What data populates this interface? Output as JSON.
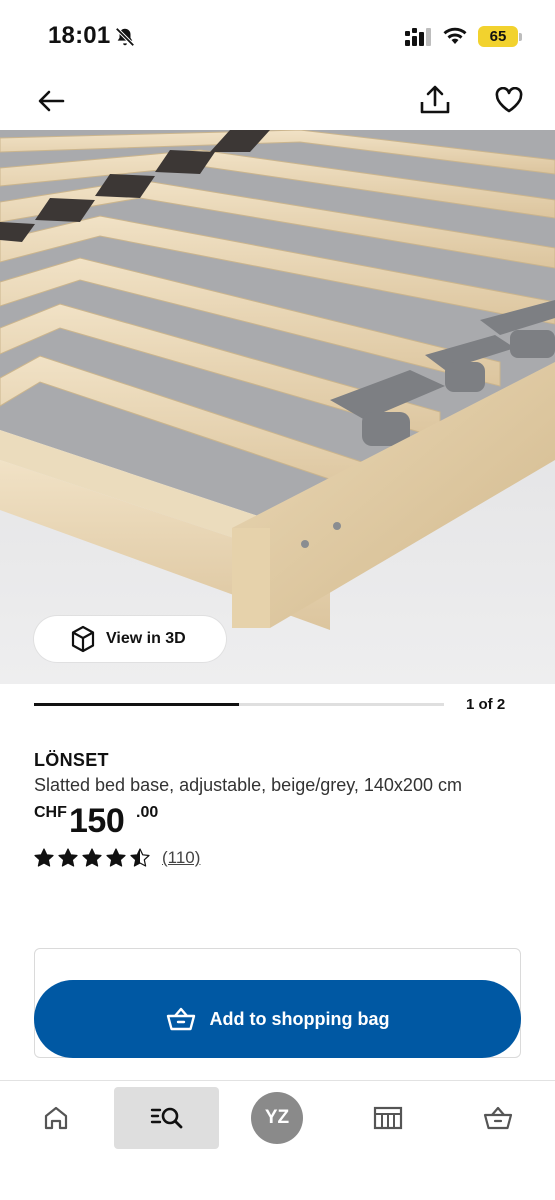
{
  "status_bar": {
    "time": "18:01",
    "battery": "65"
  },
  "product": {
    "view_3d_label": "View in 3D",
    "pager": {
      "text": "1 of 2",
      "progress": 0.5
    },
    "name": "LÖNSET",
    "description": "Slatted bed base, adjustable, beige/grey, 140x200 cm",
    "price": {
      "currency": "CHF",
      "integer": "150",
      "decimal": ".00"
    },
    "rating": {
      "stars": 4.5,
      "max": 5,
      "count": "(110)"
    }
  },
  "actions": {
    "add_to_bag_label": "Add to shopping bag"
  },
  "bottom_nav": {
    "avatar_initials": "YZ",
    "items": [
      "home-icon",
      "search-icon",
      "avatar",
      "store-icon",
      "basket-icon"
    ]
  },
  "colors": {
    "brand_blue": "#0058a3",
    "battery_yellow": "#f2d22e",
    "avatar_grey": "#8a8a8a",
    "active_tab_bg": "#dedede"
  }
}
